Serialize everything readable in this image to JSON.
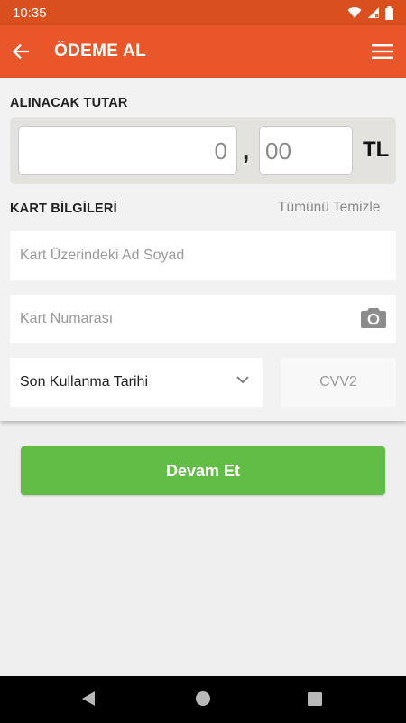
{
  "status_bar": {
    "time": "10:35"
  },
  "app_bar": {
    "title": "ÖDEME AL"
  },
  "amount": {
    "label": "ALINACAK TUTAR",
    "integer_placeholder": "0",
    "separator": ",",
    "decimal_placeholder": "00",
    "currency": "TL"
  },
  "card": {
    "label": "KART BİLGİLERİ",
    "clear_label": "Tümünü Temizle",
    "name_placeholder": "Kart Üzerindeki Ad Soyad",
    "number_placeholder": "Kart Numarası",
    "expiry_label": "Son Kullanma Tarihi",
    "cvv_placeholder": "CVV2"
  },
  "actions": {
    "continue_label": "Devam Et"
  },
  "colors": {
    "status_bar": "#d94f1e",
    "app_bar": "#e8562a",
    "primary_button": "#62bd46"
  }
}
